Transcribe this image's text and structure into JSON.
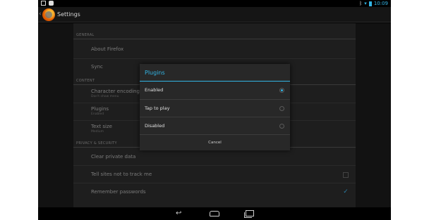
{
  "status_bar": {
    "time": "10:09",
    "icons": [
      "image-icon",
      "dropbox-icon",
      "bluetooth-icon",
      "wifi-icon",
      "battery-icon"
    ]
  },
  "action_bar": {
    "title": "Settings",
    "app_icon": "firefox-logo-icon"
  },
  "settings": {
    "sections": [
      {
        "header": "GENERAL"
      },
      {
        "header": "CONTENT"
      },
      {
        "header": "PRIVACY & SECURITY"
      }
    ],
    "items": [
      {
        "title": "About Firefox",
        "subtitle": ""
      },
      {
        "title": "Sync",
        "subtitle": ""
      },
      {
        "title": "Character encoding",
        "subtitle": "Don't show menu"
      },
      {
        "title": "Plugins",
        "subtitle": "Enabled"
      },
      {
        "title": "Text size",
        "subtitle": "Medium"
      },
      {
        "title": "Clear private data",
        "subtitle": ""
      },
      {
        "title": "Tell sites not to track me",
        "subtitle": "",
        "checked": false
      },
      {
        "title": "Remember passwords",
        "subtitle": "",
        "checked": true
      }
    ]
  },
  "dialog": {
    "title": "Plugins",
    "options": [
      {
        "label": "Enabled",
        "selected": true
      },
      {
        "label": "Tap to play",
        "selected": false
      },
      {
        "label": "Disabled",
        "selected": false
      }
    ],
    "cancel_label": "Cancel"
  },
  "colors": {
    "accent": "#33b5e5",
    "checkbox": "#2a7ea6"
  },
  "nav_bar": {
    "icons": [
      "back-icon",
      "home-icon",
      "recent-apps-icon"
    ]
  }
}
